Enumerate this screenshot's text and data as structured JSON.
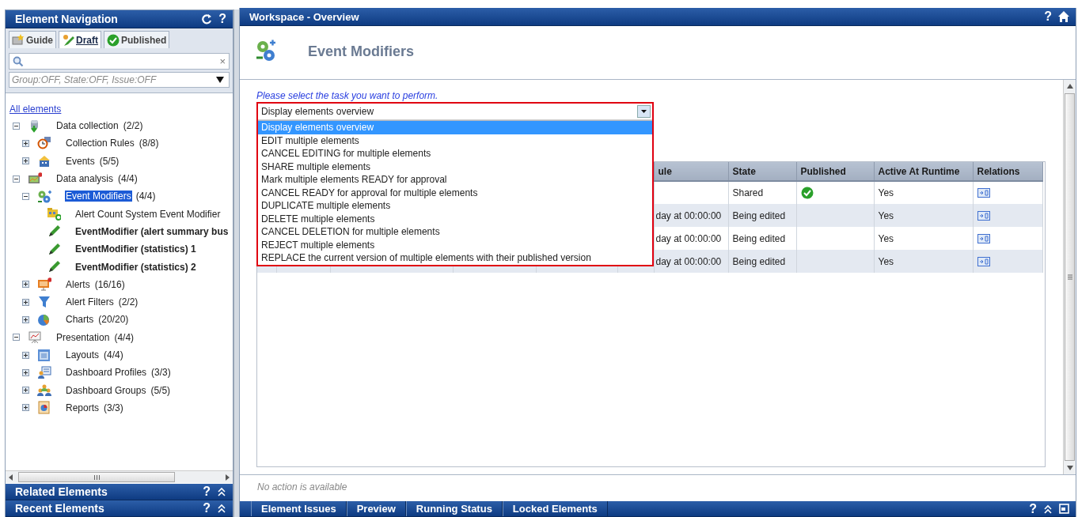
{
  "navigation": {
    "title": "Element Navigation",
    "help": "?",
    "tabs": [
      {
        "label": "Guide",
        "kind": "guide",
        "selected": false
      },
      {
        "label": "Draft",
        "kind": "draft",
        "selected": true
      },
      {
        "label": "Published",
        "kind": "published",
        "selected": false
      }
    ],
    "search": {
      "clear": "×"
    },
    "filter": {
      "value": "Group:OFF, State:OFF, Issue:OFF"
    },
    "root_link": "All elements",
    "tree": [
      {
        "label": "Data collection",
        "count": "(2/2)",
        "kind": "collection",
        "expanded": true,
        "selected": false,
        "children": [
          {
            "label": "Collection Rules",
            "count": "(8/8)",
            "kind": "rule",
            "expanded": false,
            "selected": false
          },
          {
            "label": "Events",
            "count": "(5/5)",
            "kind": "event",
            "expanded": false,
            "selected": false
          }
        ]
      },
      {
        "label": "Data analysis",
        "count": "(4/4)",
        "kind": "analysis",
        "expanded": true,
        "selected": false,
        "children": [
          {
            "label": "Event Modifiers",
            "count": "(4/4)",
            "kind": "modifier",
            "expanded": true,
            "selected": true,
            "children": [
              {
                "label": "Alert Count System Event Modifier",
                "kind": "system",
                "selected": false
              },
              {
                "label": "EventModifier (alert summary bus",
                "kind": "draft",
                "selected": false
              },
              {
                "label": "EventModifier (statistics) 1",
                "kind": "draft",
                "selected": false
              },
              {
                "label": "EventModifier (statistics) 2",
                "kind": "draft",
                "selected": false
              }
            ]
          },
          {
            "label": "Alerts",
            "count": "(16/16)",
            "kind": "alert",
            "expanded": false,
            "selected": false
          },
          {
            "label": "Alert Filters",
            "count": "(2/2)",
            "kind": "filter",
            "expanded": false,
            "selected": false
          },
          {
            "label": "Charts",
            "count": "(20/20)",
            "kind": "chart",
            "expanded": false,
            "selected": false
          }
        ]
      },
      {
        "label": "Presentation",
        "count": "(4/4)",
        "kind": "presentation",
        "expanded": true,
        "selected": false,
        "children": [
          {
            "label": "Layouts",
            "count": "(4/4)",
            "kind": "layout",
            "expanded": false,
            "selected": false
          },
          {
            "label": "Dashboard Profiles",
            "count": "(3/3)",
            "kind": "profile",
            "expanded": false,
            "selected": false
          },
          {
            "label": "Dashboard Groups",
            "count": "(5/5)",
            "kind": "group",
            "expanded": false,
            "selected": false
          },
          {
            "label": "Reports",
            "count": "(3/3)",
            "kind": "report",
            "expanded": false,
            "selected": false
          }
        ]
      }
    ],
    "bottom_panels": [
      {
        "title": "Related Elements",
        "help": "?"
      },
      {
        "title": "Recent Elements",
        "help": "?"
      }
    ]
  },
  "workspace": {
    "title": "Workspace - Overview",
    "help": "?",
    "page_title": "Event Modifiers",
    "prompt": "Please select the task you want to perform.",
    "task_dropdown": {
      "value": "Display elements overview",
      "open": true,
      "options": [
        {
          "label": "Display elements overview",
          "selected": true
        },
        {
          "label": "EDIT multiple elements",
          "selected": false
        },
        {
          "label": "CANCEL EDITING for multiple elements",
          "selected": false
        },
        {
          "label": "SHARE multiple elements",
          "selected": false
        },
        {
          "label": "Mark multiple elements READY for approval",
          "selected": false
        },
        {
          "label": "CANCEL READY for approval for multiple elements",
          "selected": false
        },
        {
          "label": "DUPLICATE multiple elements",
          "selected": false
        },
        {
          "label": "DELETE multiple elements",
          "selected": false
        },
        {
          "label": "CANCEL DELETION for multiple elements",
          "selected": false
        },
        {
          "label": "REJECT multiple elements",
          "selected": false
        },
        {
          "label": "REPLACE the current version of multiple elements with their published version",
          "selected": false
        }
      ]
    },
    "table": {
      "columns": [
        "ule",
        "State",
        "Published",
        "Active At Runtime",
        "Relations"
      ],
      "rows": [
        {
          "column_1": "",
          "state": "Shared",
          "published": true,
          "active_at_runtime": "Yes"
        },
        {
          "column_1": "day at 00:00:00",
          "state": "Being edited",
          "published": false,
          "active_at_runtime": "Yes"
        },
        {
          "column_1": "day at 00:00:00",
          "state": "Being edited",
          "published": false,
          "active_at_runtime": "Yes"
        },
        {
          "column_1": "day at 00:00:00",
          "state": "Being edited",
          "published": false,
          "active_at_runtime": "Yes"
        }
      ]
    },
    "status": "No action is available",
    "bottom_tabs": [
      "Element Issues",
      "Preview",
      "Running Status",
      "Locked Elements"
    ],
    "bottom_help": "?"
  }
}
